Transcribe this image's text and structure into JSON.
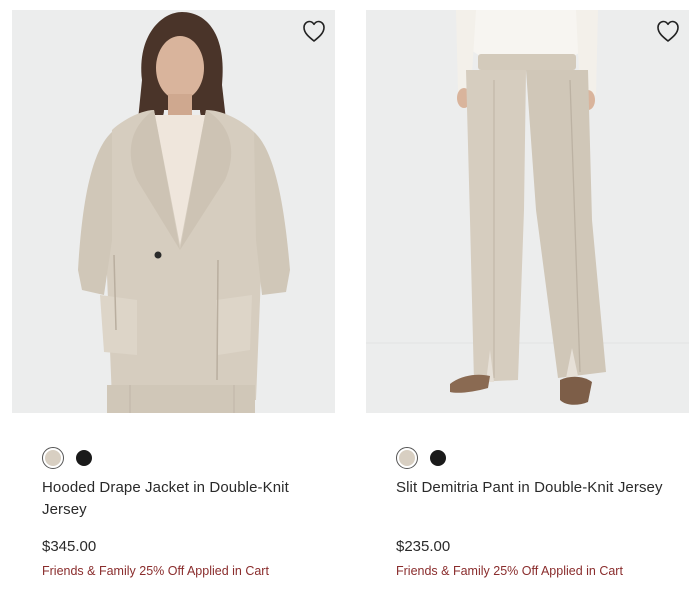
{
  "products": [
    {
      "name": "Hooded Drape Jacket in Double-Knit Jersey",
      "price": "$345.00",
      "promo": "Friends & Family 25% Off Applied in Cart",
      "swatches": [
        {
          "color": "#d8cfc2",
          "selected": true
        },
        {
          "color": "#1a1a1a",
          "selected": false
        }
      ],
      "wishlist_icon": "heart-outline-icon"
    },
    {
      "name": "Slit Demitria Pant in Double-Knit Jersey",
      "price": "$235.00",
      "promo": "Friends & Family 25% Off Applied in Cart",
      "swatches": [
        {
          "color": "#d8cfc2",
          "selected": true
        },
        {
          "color": "#1a1a1a",
          "selected": false
        }
      ],
      "wishlist_icon": "heart-outline-icon"
    }
  ],
  "colors": {
    "image_bg": "#eceded",
    "promo_text": "#8a2d2d",
    "garment": "#d6cdbf"
  }
}
